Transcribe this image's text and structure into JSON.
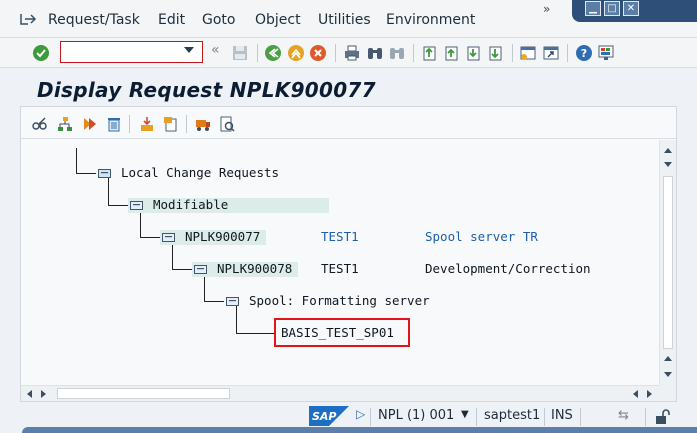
{
  "menu": {
    "items": [
      {
        "label": "Request/Task"
      },
      {
        "label": "Edit"
      },
      {
        "label": "Goto"
      },
      {
        "label": "Object"
      },
      {
        "label": "Utilities"
      },
      {
        "label": "Environment"
      }
    ]
  },
  "toolbar": {
    "command_value": ""
  },
  "title": "Display Request NPLK900077",
  "tree": {
    "root": "Local Change Requests",
    "modifiable": "Modifiable",
    "request": {
      "id": "NPLK900077",
      "owner": "TEST1",
      "desc": "Spool server TR"
    },
    "task": {
      "id": "NPLK900078",
      "owner": "TEST1",
      "desc": "Development/Correction"
    },
    "category": "Spool: Formatting server",
    "object": "BASIS_TEST_SP01"
  },
  "status": {
    "system": "NPL (1) 001",
    "host": "saptest1",
    "mode": "INS"
  },
  "colors": {
    "highlight_border": "#e0141b",
    "window_chrome": "#2d4f78",
    "title_text": "#0c1d33",
    "description_blue": "#1f5fa8"
  }
}
